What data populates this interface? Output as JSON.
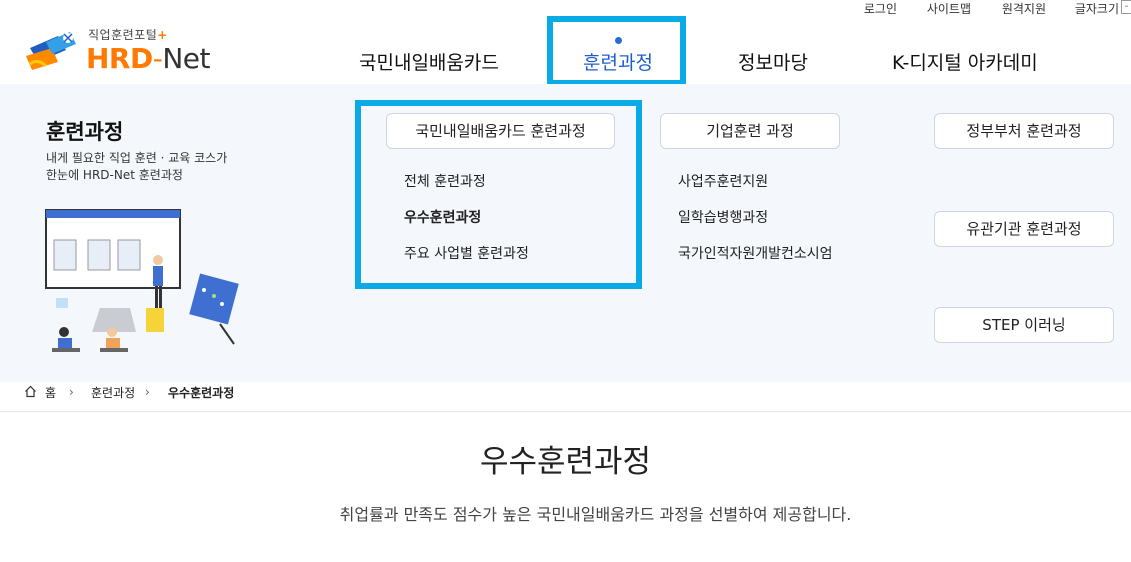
{
  "util_links": [
    "로그인",
    "사이트맵",
    "원격지원",
    "글자크기"
  ],
  "util_box": "-",
  "logo": {
    "sub": "직업훈련포털",
    "plus": "+",
    "hrd": "HRD",
    "dash": "-",
    "net": "Net"
  },
  "nav": [
    "국민내일배움카드",
    "훈련과정",
    "정보마당",
    "K-디지털 아카데미"
  ],
  "panel": {
    "title": "훈련과정",
    "desc_line1": "내게 필요한 직업 훈련 · 교육 코스가",
    "desc_line2": "한눈에 HRD-Net 훈련과정"
  },
  "categories": {
    "card": "국민내일배움카드 훈련과정",
    "corp": "기업훈련 과정",
    "gov": "정부부처 훈련과정",
    "agency": "유관기관 훈련과정",
    "step": "STEP 이러닝"
  },
  "card_links": [
    "전체 훈련과정",
    "우수훈련과정",
    "주요 사업별 훈련과정"
  ],
  "corp_links": [
    "사업주훈련지원",
    "일학습병행과정",
    "국가인적자원개발컨소시엄"
  ],
  "breadcrumb": [
    "홈",
    "훈련과정",
    "우수훈련과정"
  ],
  "page": {
    "title": "우수훈련과정",
    "desc": "취업률과 만족도 점수가 높은 국민내일배움카드 과정을 선별하여 제공합니다."
  },
  "colors": {
    "highlight": "#0aaae6",
    "active_nav": "#1d5fd0",
    "brand_orange": "#ff7a00"
  }
}
